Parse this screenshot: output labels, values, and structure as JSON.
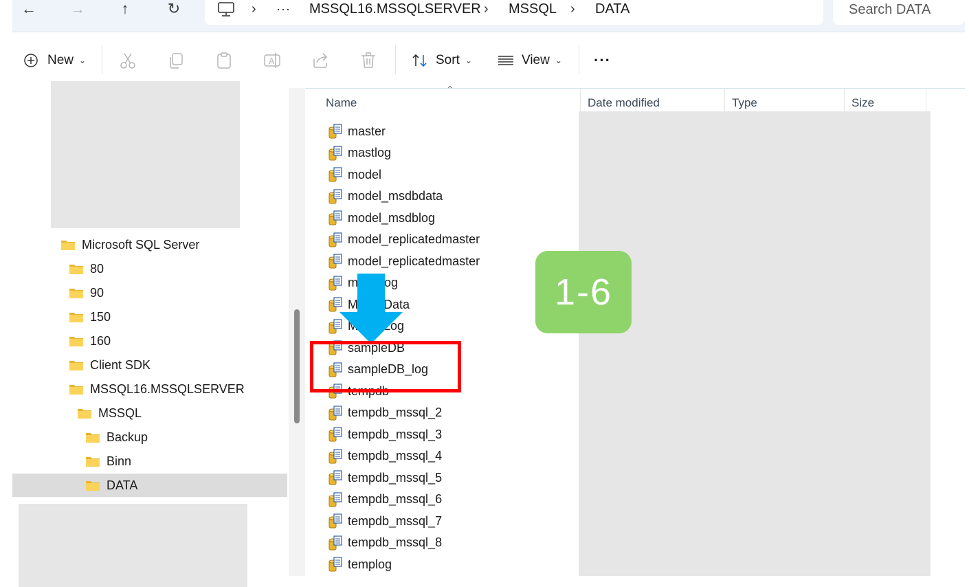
{
  "address_bar": {
    "breadcrumb_overflow": "···",
    "breadcrumbs": [
      "MSSQL16.MSSQLSERVER",
      "MSSQL",
      "DATA"
    ],
    "search_placeholder": "Search DATA"
  },
  "toolbar": {
    "new_label": "New",
    "sort_label": "Sort",
    "view_label": "View",
    "more_label": "···"
  },
  "nav_pane": {
    "items": [
      {
        "label": "Microsoft SQL Server"
      },
      {
        "label": "80"
      },
      {
        "label": "90"
      },
      {
        "label": "150"
      },
      {
        "label": "160"
      },
      {
        "label": "Client SDK"
      },
      {
        "label": "MSSQL16.MSSQLSERVER"
      },
      {
        "label": "MSSQL"
      },
      {
        "label": "Backup"
      },
      {
        "label": "Binn"
      },
      {
        "label": "DATA"
      }
    ],
    "selected": "DATA"
  },
  "file_list": {
    "columns": {
      "name": "Name",
      "date_modified": "Date modified",
      "type": "Type",
      "size": "Size"
    },
    "files": [
      {
        "name": "master",
        "icon": "sql-data-file-icon"
      },
      {
        "name": "mastlog",
        "icon": "sql-log-file-icon"
      },
      {
        "name": "model",
        "icon": "sql-data-file-icon"
      },
      {
        "name": "model_msdbdata",
        "icon": "sql-data-file-icon"
      },
      {
        "name": "model_msdblog",
        "icon": "sql-log-file-icon"
      },
      {
        "name": "model_replicatedmaster",
        "icon": "sql-log-file-icon"
      },
      {
        "name": "model_replicatedmaster",
        "icon": "sql-data-file-icon"
      },
      {
        "name": "modellog",
        "icon": "sql-log-file-icon"
      },
      {
        "name": "MSDBData",
        "icon": "sql-data-file-icon"
      },
      {
        "name": "MSDBLog",
        "icon": "sql-log-file-icon"
      },
      {
        "name": "sampleDB",
        "icon": "sql-data-file-icon"
      },
      {
        "name": "sampleDB_log",
        "icon": "sql-log-file-icon"
      },
      {
        "name": "tempdb",
        "icon": "sql-data-file-icon"
      },
      {
        "name": "tempdb_mssql_2",
        "icon": "sql-data-file-icon"
      },
      {
        "name": "tempdb_mssql_3",
        "icon": "sql-data-file-icon"
      },
      {
        "name": "tempdb_mssql_4",
        "icon": "sql-data-file-icon"
      },
      {
        "name": "tempdb_mssql_5",
        "icon": "sql-data-file-icon"
      },
      {
        "name": "tempdb_mssql_6",
        "icon": "sql-data-file-icon"
      },
      {
        "name": "tempdb_mssql_7",
        "icon": "sql-data-file-icon"
      },
      {
        "name": "tempdb_mssql_8",
        "icon": "sql-data-file-icon"
      },
      {
        "name": "templog",
        "icon": "sql-log-file-icon"
      }
    ]
  },
  "annotation": {
    "step_badge": "1-6",
    "badge_color": "#8fd46b",
    "highlight_color": "#ff0000",
    "arrow_color": "#00b0f0"
  }
}
